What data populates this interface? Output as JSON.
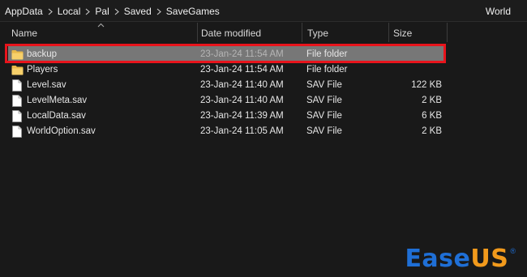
{
  "breadcrumb": {
    "items": [
      "AppData",
      "Local",
      "Pal",
      "Saved",
      "SaveGames"
    ],
    "trailing": "World"
  },
  "columns": {
    "name": "Name",
    "date_modified": "Date modified",
    "type": "Type",
    "size": "Size"
  },
  "files": [
    {
      "name": "backup",
      "date": "23-Jan-24 11:54 AM",
      "type": "File folder",
      "size": "",
      "icon": "folder-icon",
      "selected": true
    },
    {
      "name": "Players",
      "date": "23-Jan-24 11:54 AM",
      "type": "File folder",
      "size": "",
      "icon": "folder-icon"
    },
    {
      "name": "Level.sav",
      "date": "23-Jan-24 11:40 AM",
      "type": "SAV File",
      "size": "122 KB",
      "icon": "file-icon"
    },
    {
      "name": "LevelMeta.sav",
      "date": "23-Jan-24 11:40 AM",
      "type": "SAV File",
      "size": "2 KB",
      "icon": "file-icon"
    },
    {
      "name": "LocalData.sav",
      "date": "23-Jan-24 11:39 AM",
      "type": "SAV File",
      "size": "6 KB",
      "icon": "file-icon"
    },
    {
      "name": "WorldOption.sav",
      "date": "23-Jan-24 11:05 AM",
      "type": "SAV File",
      "size": "2 KB",
      "icon": "file-icon"
    }
  ],
  "watermark": {
    "part1": "Ease",
    "part2": "US",
    "mark": "®",
    "color_blue": "#1f6fd6",
    "color_orange": "#f29a1c"
  },
  "colors": {
    "highlight": "#e8141c",
    "selection": "#777777",
    "background": "#191919"
  }
}
